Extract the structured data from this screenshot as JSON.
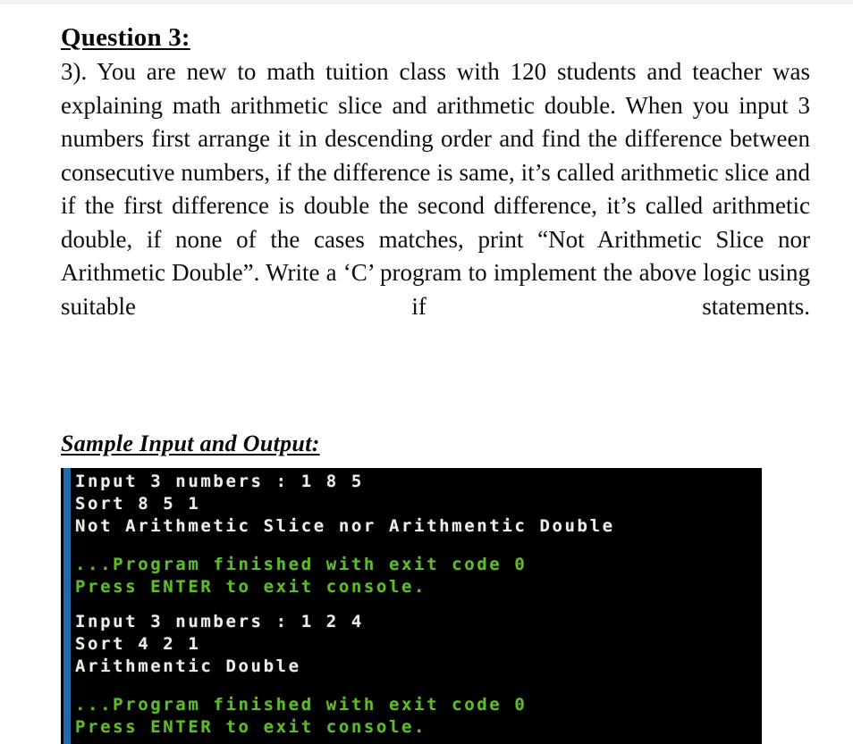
{
  "document": {
    "question_heading": "Question 3:",
    "question_body": "3). You are new to math tuition class with 120 students and teacher was explaining math arithmetic slice and arithmetic double. When you input 3 numbers first arrange it in descending order and find the difference between consecutive numbers, if the difference is same, it’s called arithmetic slice and if the first difference is double the second difference, it’s called arithmetic double, if none of the cases matches, print “Not Arithmetic Slice nor Arithmetic Double”. Write a ‘C’ program to implement the above logic using suitable if statements.",
    "sample_heading": "Sample Input and Output:"
  },
  "terminal": {
    "background_color": "#000000",
    "accent_color": "#1f6bab",
    "output_color": "#ededed",
    "status_color": "#5fbb2e",
    "run1": {
      "line1": "Input 3 numbers : 1 8 5",
      "line2": "Sort 8 5 1",
      "line3": "Not Arithmetic Slice nor Arithmentic Double",
      "finished": "...Program finished with exit code 0",
      "prompt": "Press ENTER to exit console."
    },
    "run2": {
      "line1": "Input 3 numbers : 1 2 4",
      "line2": "Sort 4 2 1",
      "line3": "Arithmentic Double",
      "finished": "...Program finished with exit code 0",
      "prompt": "Press ENTER to exit console."
    }
  }
}
